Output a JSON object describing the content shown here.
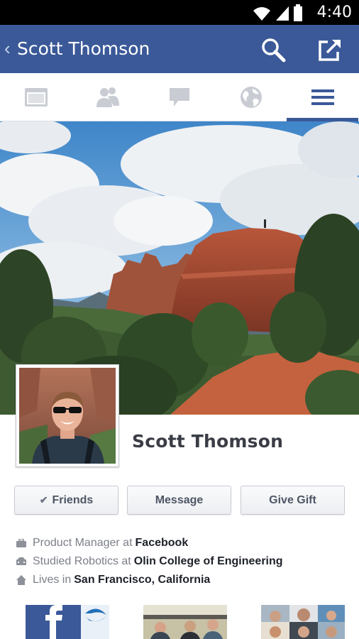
{
  "status_bar": {
    "time": "4:40"
  },
  "app_bar": {
    "title": "Scott Thomson",
    "back_icon": "chevron-left-icon",
    "search_icon": "search-icon",
    "share_icon": "share-icon"
  },
  "tabs": [
    {
      "icon": "news-feed-icon",
      "active": false
    },
    {
      "icon": "friends-icon",
      "active": false
    },
    {
      "icon": "messages-icon",
      "active": false
    },
    {
      "icon": "globe-icon",
      "active": false
    },
    {
      "icon": "menu-icon",
      "active": true
    }
  ],
  "profile": {
    "name": "Scott Thomson"
  },
  "buttons": {
    "friends": "Friends",
    "message": "Message",
    "give_gift": "Give Gift"
  },
  "about": {
    "work_prefix": "Product Manager at",
    "work_place": "Facebook",
    "study_prefix": "Studied Robotics at",
    "study_place": "Olin College of Engineering",
    "home_prefix": "Lives in",
    "home_place": "San Francisco, California"
  },
  "colors": {
    "brand": "#3b5998",
    "status_bar": "#000000",
    "text_dark": "#1d2129",
    "text_muted": "#7b7f88"
  }
}
